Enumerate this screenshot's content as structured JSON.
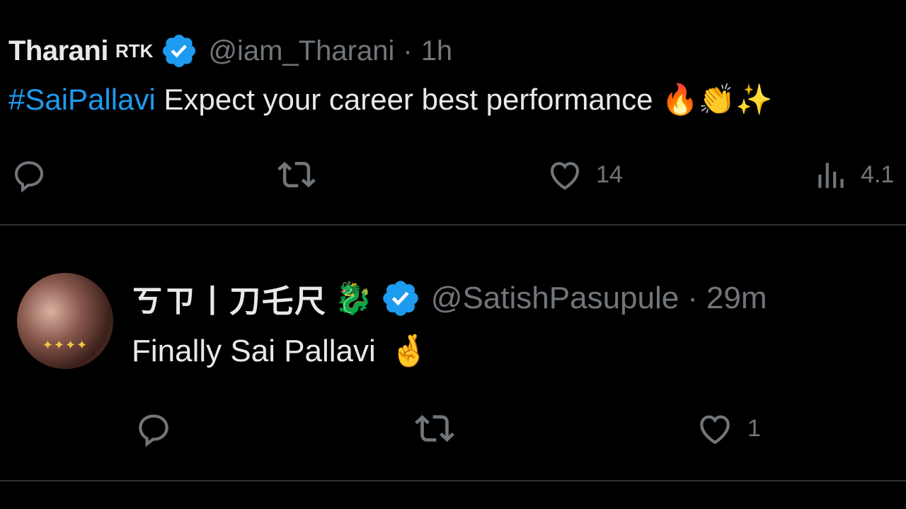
{
  "tweets": [
    {
      "display_name": "Tharani",
      "name_suffix": "RTK",
      "handle": "@iam_Tharani",
      "separator": "·",
      "time": "1h",
      "hashtag": "#SaiPallavi",
      "text": " Expect  your career best performance",
      "emojis": "🔥👏✨",
      "actions": {
        "reply_icon": "reply-icon",
        "retweet_icon": "retweet-icon",
        "like_icon": "heart-icon",
        "like_count": "14",
        "views_icon": "analytics-icon",
        "view_count": "4.1"
      }
    },
    {
      "display_name": "ㄎㄗ丨刀乇尺",
      "name_emoji": "🐉",
      "handle": "@SatishPasupule",
      "separator": "·",
      "time": "29m",
      "text": "Finally Sai Pallavi",
      "emojis": "🤞",
      "actions": {
        "reply_icon": "reply-icon",
        "retweet_icon": "retweet-icon",
        "like_icon": "heart-icon",
        "like_count": "1"
      }
    }
  ],
  "colors": {
    "background": "#000000",
    "text": "#e7e9ea",
    "muted": "#71767b",
    "link": "#1d9bf0",
    "divider": "#2f3336",
    "verified": "#1d9bf0"
  }
}
